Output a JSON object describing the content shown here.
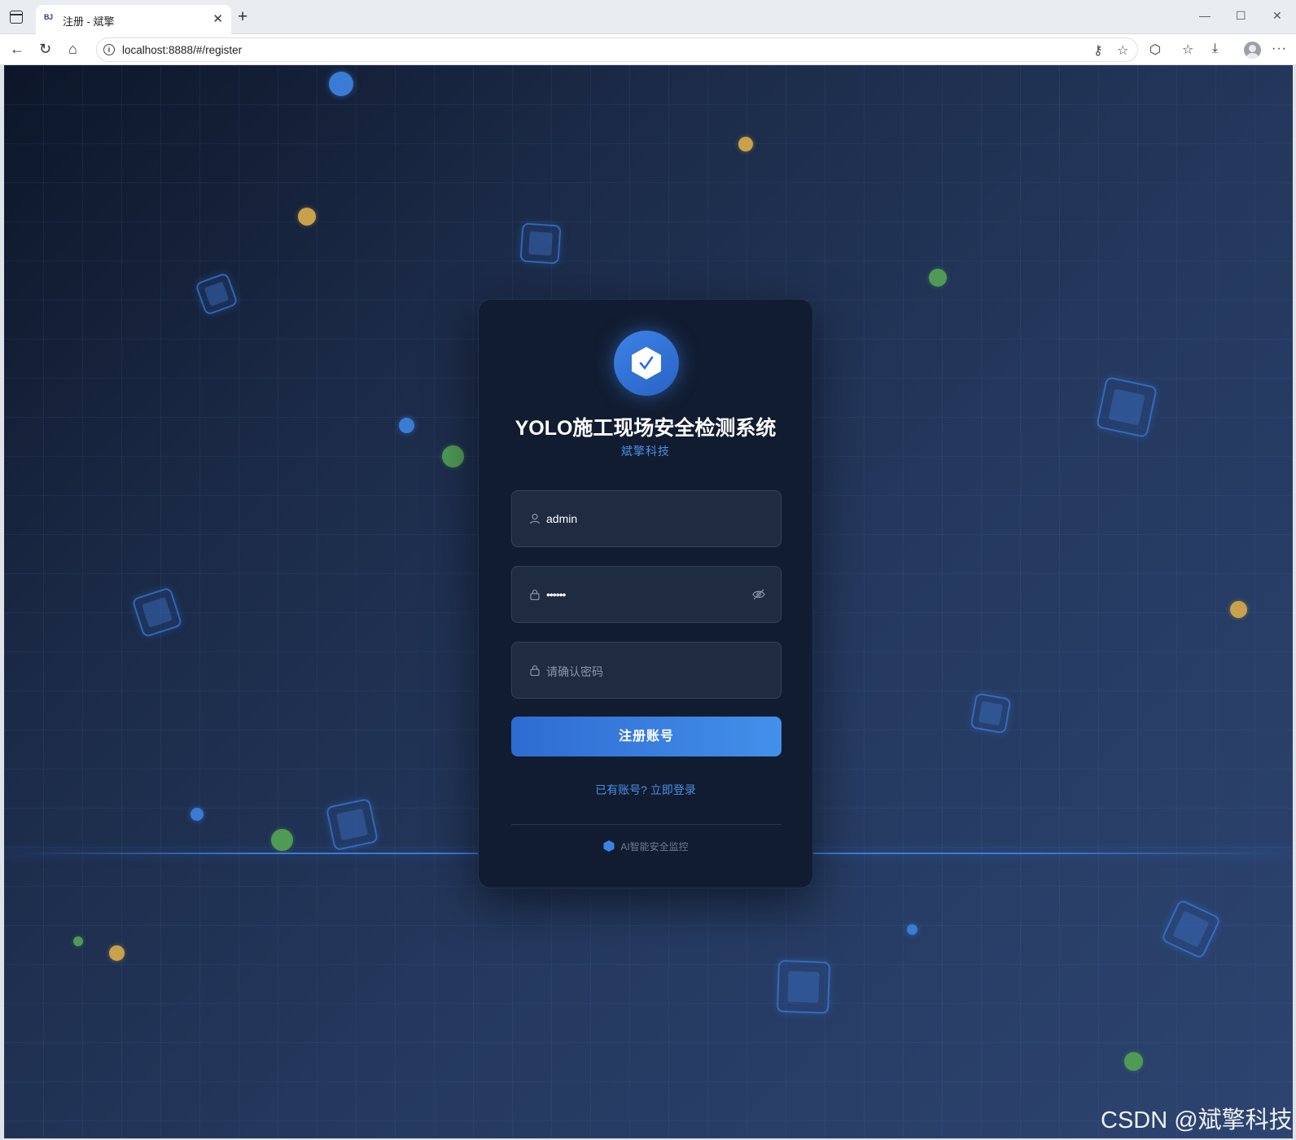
{
  "browser": {
    "tab_favicon": "BJ",
    "tab_title": "注册 - 斌擎",
    "url": "localhost:8888/#/register"
  },
  "page": {
    "app_title": "YOLO施工现场安全检测系统",
    "company": "斌擎科技",
    "username_value": "admin",
    "password_value": "••••••",
    "confirm_placeholder": "请确认密码",
    "submit_label": "注册账号",
    "login_link": "已有账号? 立即登录",
    "footer_text": "AI智能安全监控"
  },
  "watermark": "CSDN @斌擎科技",
  "colors": {
    "accent": "#3b82e6",
    "card_bg": "#111c30",
    "link": "#4a8fe7",
    "input_bg": "#1f2b40"
  }
}
